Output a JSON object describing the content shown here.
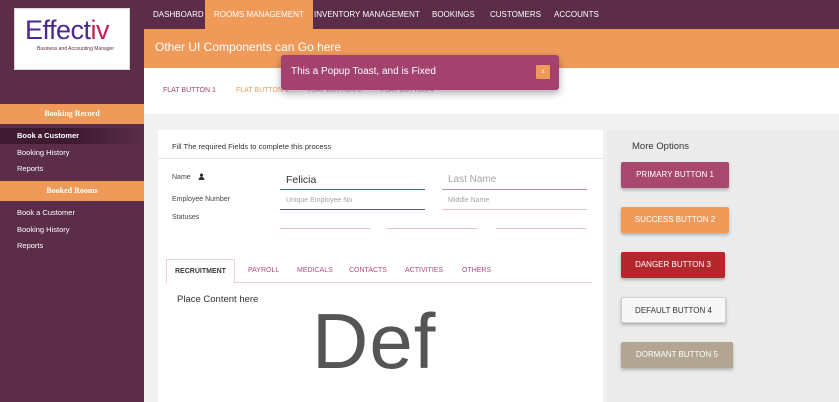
{
  "logo": {
    "prefix": "Effect",
    "suffix": "iv",
    "tagline": "Business and Accounting Manager"
  },
  "nav": {
    "items": [
      {
        "label": "Dashboard"
      },
      {
        "label": "Rooms Management"
      },
      {
        "label": "Inventory Management"
      },
      {
        "label": "Bookings"
      },
      {
        "label": "Customers"
      },
      {
        "label": "Accounts"
      }
    ]
  },
  "banner": {
    "text": "Other UI Components can Go here"
  },
  "flat_buttons": [
    "Flat Button 1",
    "Flat Button 2",
    "Flat Button 3",
    "Flat Button 4"
  ],
  "toast": {
    "text": "This a Popup Toast, and is Fixed",
    "close": "x"
  },
  "sidebar": {
    "booking_record": {
      "header": "Booking Record",
      "items": [
        "Book a Customer",
        "Booking History",
        "Reports"
      ]
    },
    "booked_rooms": {
      "header": "Booked Rooms",
      "items": [
        "Book a Customer",
        "Booking History",
        "Reports"
      ]
    }
  },
  "form": {
    "title": "Fill The required Fields to complete this process",
    "name_label": "Name",
    "first_name_value": "Felicia",
    "last_name_placeholder": "Last Name",
    "employee_label": "Employee Number",
    "employee_placeholder": "Unique Employee No",
    "middle_placeholder": "Middle Name",
    "statuses_label": "Statuses"
  },
  "tabs": [
    "Recruitment",
    "Payroll",
    "Medicals",
    "Contacts",
    "Activities",
    "Others"
  ],
  "tab_content": {
    "text": "Place Content here",
    "big_text": "Def"
  },
  "more_options": {
    "title": "More Options",
    "primary": "Primary Button 1",
    "success": "Success Button 2",
    "danger": "Danger Button 3",
    "default": "Default Button 4",
    "dormant": "Dormant Button 5"
  },
  "colors": {
    "plum": "#5b2d49",
    "orange": "#f09a5a",
    "magenta": "#a3426f",
    "danger": "#b3272d",
    "dormant": "#b2a592"
  }
}
